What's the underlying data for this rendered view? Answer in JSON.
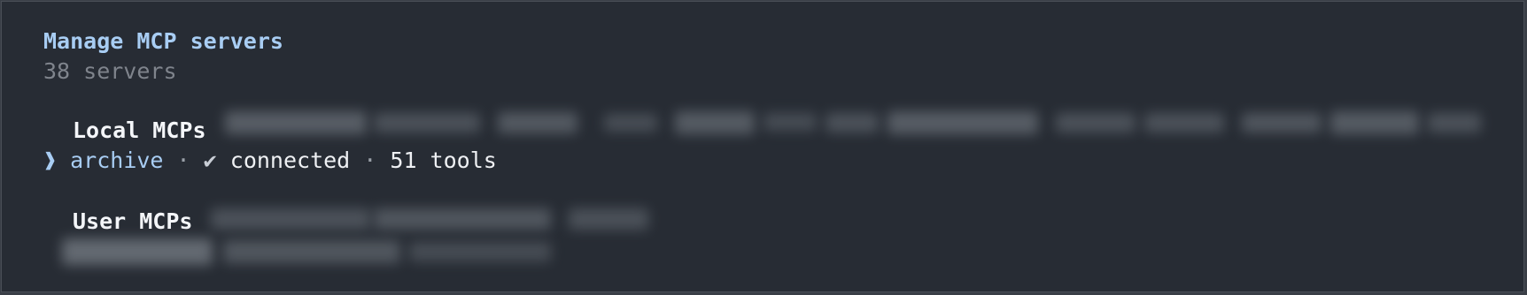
{
  "panel": {
    "title": "Manage MCP servers",
    "server_count": "38 servers"
  },
  "sections": {
    "local": {
      "heading": "Local MCPs",
      "selected_server": {
        "pointer": "❱",
        "name": "archive",
        "separator_1": " · ",
        "status_icon": "✔",
        "status": "connected",
        "separator_2": " · ",
        "tools": "51 tools"
      }
    },
    "user": {
      "heading": "User MCPs"
    }
  },
  "colors": {
    "background": "#272c34",
    "accent": "#a8cdf3",
    "muted": "#7f848c",
    "text": "#eef0f3"
  }
}
